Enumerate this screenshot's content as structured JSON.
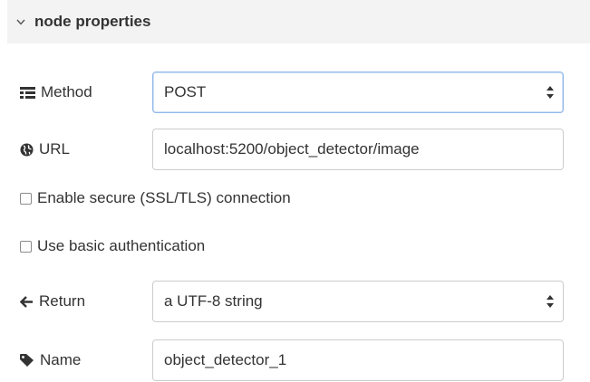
{
  "section": {
    "title": "node properties",
    "expanded": true
  },
  "method": {
    "label": "Method",
    "icon": "list-icon",
    "selected": "POST"
  },
  "url": {
    "label": "URL",
    "icon": "globe-icon",
    "value": "localhost:5200/object_detector/image"
  },
  "options": {
    "ssl": {
      "label": "Enable secure (SSL/TLS) connection",
      "checked": false
    },
    "auth": {
      "label": "Use basic authentication",
      "checked": false
    }
  },
  "return": {
    "label": "Return",
    "icon": "arrow-left-icon",
    "selected": "a UTF-8 string"
  },
  "name": {
    "label": "Name",
    "icon": "tag-icon",
    "value": "object_detector_1"
  }
}
